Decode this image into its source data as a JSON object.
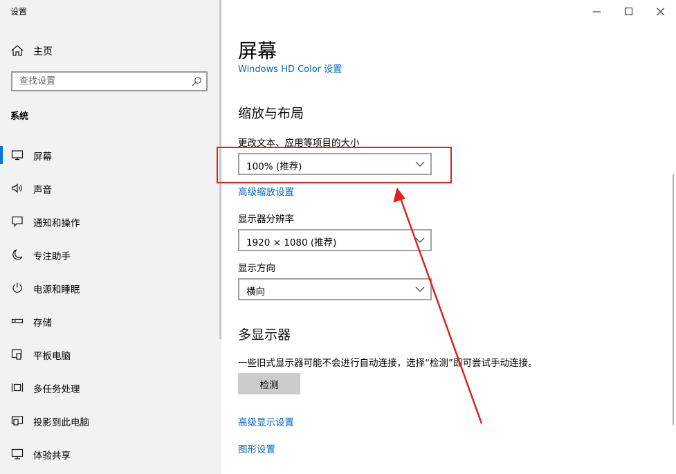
{
  "window": {
    "title": "设置"
  },
  "sidebar": {
    "home_label": "主页",
    "search_placeholder": "查找设置",
    "section": "系统",
    "items": [
      {
        "label": "屏幕",
        "icon": "monitor-icon",
        "active": true
      },
      {
        "label": "声音",
        "icon": "speaker-icon"
      },
      {
        "label": "通知和操作",
        "icon": "notification-icon"
      },
      {
        "label": "专注助手",
        "icon": "moon-icon"
      },
      {
        "label": "电源和睡眠",
        "icon": "power-icon"
      },
      {
        "label": "存储",
        "icon": "storage-icon"
      },
      {
        "label": "平板电脑",
        "icon": "tablet-icon"
      },
      {
        "label": "多任务处理",
        "icon": "multitask-icon"
      },
      {
        "label": "投影到此电脑",
        "icon": "project-icon"
      },
      {
        "label": "体验共享",
        "icon": "share-icon"
      }
    ]
  },
  "main": {
    "title": "屏幕",
    "hd_color_link": "Windows HD Color 设置",
    "scale_section": {
      "heading": "缩放与布局",
      "scale_label": "更改文本、应用等项目的大小",
      "scale_value": "100% (推荐)",
      "advanced_scaling_link": "高级缩放设置",
      "resolution_label": "显示器分辨率",
      "resolution_value": "1920 × 1080 (推荐)",
      "orientation_label": "显示方向",
      "orientation_value": "横向"
    },
    "multi_display": {
      "heading": "多显示器",
      "description": "一些旧式显示器可能不会进行自动连接，选择“检测”即可尝试手动连接。",
      "detect_button": "检测",
      "advanced_display_link": "高级显示设置",
      "graphics_link": "图形设置"
    }
  },
  "colors": {
    "accent": "#0078d7",
    "link": "#0067c0",
    "annotation": "#e02020"
  }
}
